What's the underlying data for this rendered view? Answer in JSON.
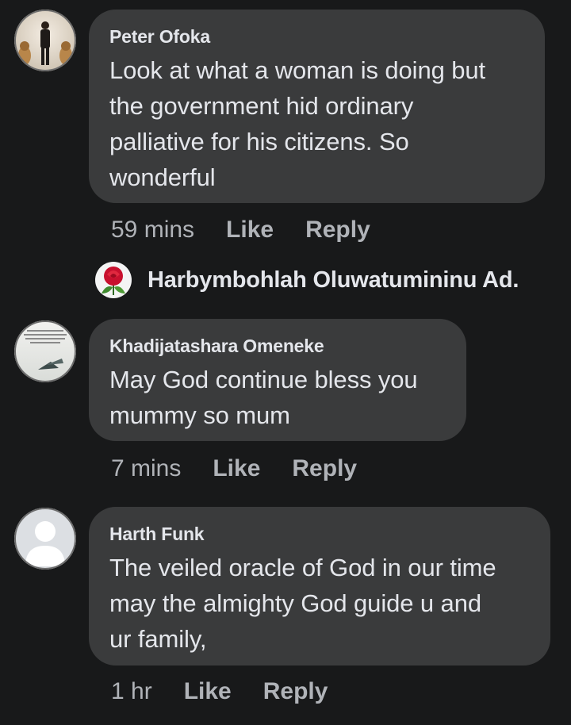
{
  "comments": [
    {
      "author": "Peter Ofoka",
      "text": "Look at what a woman is doing but\nthe government hid ordinary\npalliative for his citizens. So\nwonderful",
      "time": "59 mins",
      "like_label": "Like",
      "reply_label": "Reply",
      "avatar_icon": "person-photo-avatar"
    },
    {
      "author": "Khadijatashara Omeneke",
      "text": "May God continue bless you\nmummy so mum",
      "time": "7 mins",
      "like_label": "Like",
      "reply_label": "Reply",
      "avatar_icon": "quote-photo-avatar"
    },
    {
      "author": "Harth Funk",
      "text": "The veiled oracle of God in our time\nmay the almighty God guide u and\nur family,",
      "time": "1 hr",
      "like_label": "Like",
      "reply_label": "Reply",
      "avatar_icon": "default-user-avatar"
    }
  ],
  "reply_preview": {
    "name": "Harbymbohlah Oluwatumininu Ad.",
    "avatar_icon": "rose-avatar"
  },
  "colors": {
    "background": "#18191a",
    "bubble": "#3a3b3c",
    "text": "#e4e6eb",
    "meta": "#b0b3b8"
  }
}
